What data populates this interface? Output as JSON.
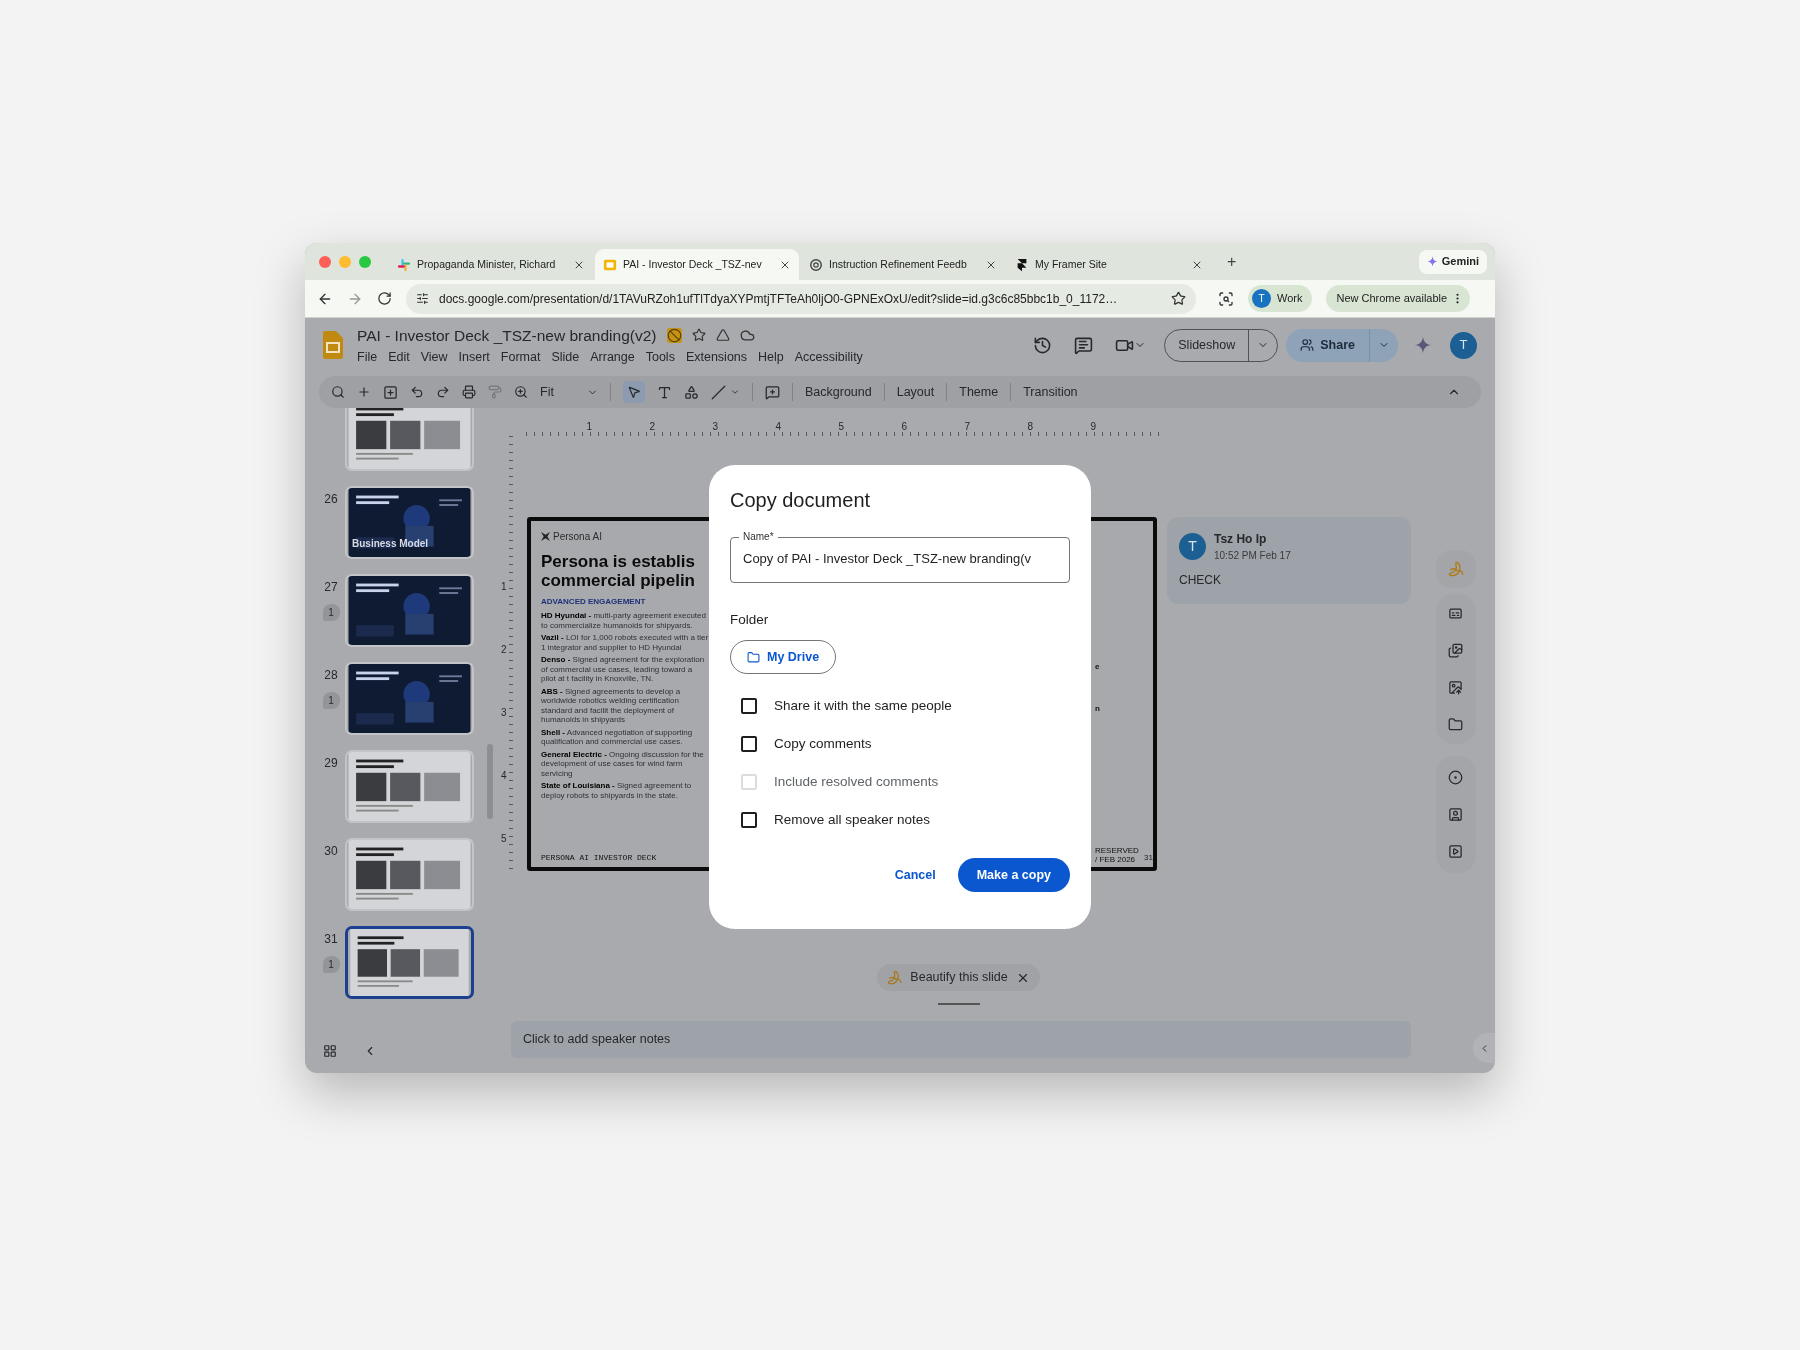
{
  "browser": {
    "tabs": [
      {
        "kind": "slack",
        "title": "Propaganda Minister, Richard",
        "selected": false
      },
      {
        "kind": "slides",
        "title": "PAI - Investor Deck _TSZ-nev",
        "selected": true
      },
      {
        "kind": "openai",
        "title": "Instruction Refinement Feedb",
        "selected": false
      },
      {
        "kind": "framer",
        "title": "My Framer Site",
        "selected": false
      }
    ],
    "new_tab": "+",
    "gemini": "Gemini",
    "url": "docs.google.com/presentation/d/1TAVuRZoh1ufTlTdyaXYPmtjTFTeAh0ljO0-GPNExOxU/edit?slide=id.g3c6c85bbc1b_0_1172…",
    "profile": {
      "initial": "T",
      "label": "Work"
    },
    "update": "New Chrome available"
  },
  "app": {
    "title": "PAI - Investor Deck _TSZ-new branding(v2)",
    "menus": [
      "File",
      "Edit",
      "View",
      "Insert",
      "Format",
      "Slide",
      "Arrange",
      "Tools",
      "Extensions",
      "Help",
      "Accessibility"
    ],
    "slideshow": "Slideshow",
    "share": "Share",
    "avatar": "T",
    "zoom": "Fit",
    "toolbar_buttons": [
      "Background",
      "Layout",
      "Theme",
      "Transition"
    ]
  },
  "ruler": {
    "horizontal": [
      "1",
      "2",
      "3",
      "4",
      "5",
      "6",
      "7",
      "8",
      "9"
    ],
    "vertical": [
      "1",
      "2",
      "3",
      "4",
      "5"
    ]
  },
  "filmstrip": [
    {
      "kind": "light",
      "selected": false
    },
    {
      "number": "26",
      "kind": "dark",
      "caption": "Business Model",
      "selected": false
    },
    {
      "number": "27",
      "kind": "dark",
      "comments": "1",
      "selected": false
    },
    {
      "number": "28",
      "kind": "dark",
      "comments": "1",
      "selected": false
    },
    {
      "number": "29",
      "kind": "light",
      "selected": false
    },
    {
      "number": "30",
      "kind": "light",
      "selected": false
    },
    {
      "number": "31",
      "kind": "light",
      "comments": "1",
      "selected": true
    }
  ],
  "slide": {
    "logo": "Persona AI",
    "title_lines": [
      "Persona is establis",
      "commercial pipelin"
    ],
    "section": "ADVANCED ENGAGEMENT",
    "entries": [
      "**HD Hyundai -** multi-party agreement executed to commercialize humanoids for shipyards.",
      "**Vazil -** LOI for 1,000 robots executed with a tier 1 integrator and supplier to HD Hyundai",
      "**Denso -** Signed agreement for the exploration of commercial use cases, leading toward a pilot at t facility in Knoxville, TN.",
      "**ABS -** Signed agreements to develop a worldwide robotics welding certification standard and facilit the deployment of humanoids in shipyards",
      "**Shell -** Advanced negotiation of supporting qualification and commercial use cases.",
      "**General Electric -** Ongoing discussion for the development of use cases for wind farm servicing",
      "**State of Louisiana -** Signed agreement to deploy robots to shipyards in the state."
    ],
    "footer": "PERSONA AI INVESTOR DECK",
    "right_fragments": [
      "e",
      "n"
    ],
    "right_footer": "RESERVED / FEB 2026",
    "page": "31"
  },
  "comment": {
    "initial": "T",
    "author": "Tsz Ho Ip",
    "time": "10:52 PM Feb 17",
    "text": "CHECK"
  },
  "beautify": "Beautify this slide",
  "speaker_notes": {
    "placeholder": "Click to add speaker notes"
  },
  "dialog": {
    "title": "Copy document",
    "name_label": "Name*",
    "name_value": "Copy of PAI - Investor Deck _TSZ-new branding(v",
    "folder_label": "Folder",
    "folder": "My Drive",
    "options": [
      {
        "label": "Share it with the same people",
        "checked": false,
        "disabled": false
      },
      {
        "label": "Copy comments",
        "checked": false,
        "disabled": false
      },
      {
        "label": "Include resolved comments",
        "checked": false,
        "disabled": true
      },
      {
        "label": "Remove all speaker notes",
        "checked": false,
        "disabled": false
      }
    ],
    "cancel": "Cancel",
    "confirm": "Make a copy"
  }
}
